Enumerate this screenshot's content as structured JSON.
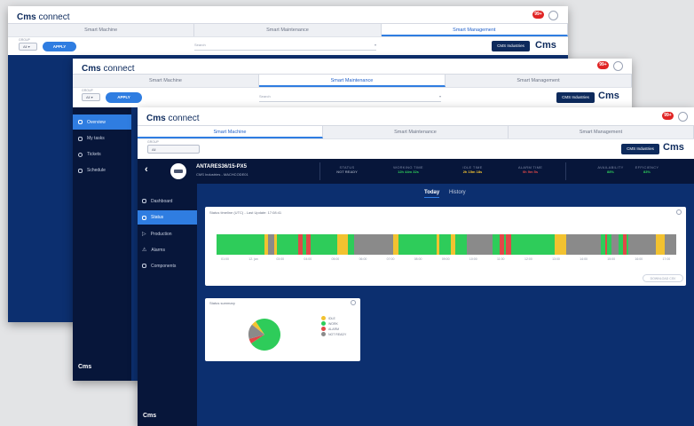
{
  "app": {
    "logo_bold": "Cms",
    "logo_light": "connect",
    "notif_count": "99+",
    "brand": "Cms"
  },
  "tabs": [
    "Smart Machine",
    "Smart Maintenance",
    "Smart Management"
  ],
  "filters": {
    "group_label": "GROUP",
    "group_value": "All",
    "apply_label": "APPLY",
    "search_placeholder": "Search",
    "company_button": "CMS Industries"
  },
  "sidebar_back": {
    "items": [
      "Overview",
      "My tasks",
      "Tickets",
      "Schedule"
    ]
  },
  "sidebar_front": {
    "items": [
      "Dashboard",
      "Status",
      "Production",
      "Alarms",
      "Components"
    ]
  },
  "machine": {
    "name": "ANTARES36/15-PX5",
    "sub": "CMS Industries - MACHCODE01",
    "back_icon": "chevron-left-icon",
    "kpis": [
      {
        "label": "STATUS",
        "value": "NOT READY",
        "color": "#8a93a8"
      },
      {
        "label": "WORKING TIME",
        "value": "12h 44m 32s",
        "color": "#2ecc5a"
      },
      {
        "label": "IDLE TIME",
        "value": "2h 15m 18s",
        "color": "#f2c230"
      },
      {
        "label": "ALARM TIME",
        "value": "0h 9m 5s",
        "color": "#e04848"
      },
      {
        "label": "AVAILABILITY",
        "value": "88%",
        "color": "#2ecc5a"
      },
      {
        "label": "EFFICIENCY",
        "value": "83%",
        "color": "#2ecc5a"
      }
    ]
  },
  "view_tabs": {
    "today": "Today",
    "history": "History"
  },
  "timeline": {
    "title": "Status timeline (UTC) - Last Update: 17:08:41",
    "ticks": [
      "01:00",
      "12. jan",
      "03:00",
      "04:00",
      "05:00",
      "06:00",
      "07:00",
      "08:00",
      "09:00",
      "10:00",
      "11:00",
      "12:00",
      "13:00",
      "14:00",
      "15:00",
      "16:00",
      "17:00"
    ],
    "download_label": "DOWNLOAD CSV",
    "colors": {
      "working": "#2ecc5a",
      "idle": "#f2c230",
      "alarm": "#e04848",
      "not_ready": "#8a8a8a"
    },
    "segments": [
      {
        "state": "working",
        "start": 0.0,
        "end": 0.105
      },
      {
        "state": "idle",
        "start": 0.105,
        "end": 0.112
      },
      {
        "state": "not_ready",
        "start": 0.112,
        "end": 0.125
      },
      {
        "state": "idle",
        "start": 0.125,
        "end": 0.132
      },
      {
        "state": "working",
        "start": 0.132,
        "end": 0.178
      },
      {
        "state": "alarm",
        "start": 0.178,
        "end": 0.188
      },
      {
        "state": "working",
        "start": 0.188,
        "end": 0.195
      },
      {
        "state": "alarm",
        "start": 0.195,
        "end": 0.205
      },
      {
        "state": "working",
        "start": 0.205,
        "end": 0.262
      },
      {
        "state": "idle",
        "start": 0.262,
        "end": 0.285
      },
      {
        "state": "working",
        "start": 0.285,
        "end": 0.3
      },
      {
        "state": "not_ready",
        "start": 0.3,
        "end": 0.385
      },
      {
        "state": "idle",
        "start": 0.385,
        "end": 0.395
      },
      {
        "state": "working",
        "start": 0.395,
        "end": 0.478
      },
      {
        "state": "idle",
        "start": 0.478,
        "end": 0.485
      },
      {
        "state": "working",
        "start": 0.485,
        "end": 0.51
      },
      {
        "state": "idle",
        "start": 0.51,
        "end": 0.52
      },
      {
        "state": "working",
        "start": 0.52,
        "end": 0.545
      },
      {
        "state": "not_ready",
        "start": 0.545,
        "end": 0.6
      },
      {
        "state": "working",
        "start": 0.6,
        "end": 0.615
      },
      {
        "state": "alarm",
        "start": 0.615,
        "end": 0.625
      },
      {
        "state": "working",
        "start": 0.625,
        "end": 0.63
      },
      {
        "state": "alarm",
        "start": 0.63,
        "end": 0.64
      },
      {
        "state": "working",
        "start": 0.64,
        "end": 0.735
      },
      {
        "state": "idle",
        "start": 0.735,
        "end": 0.76
      },
      {
        "state": "not_ready",
        "start": 0.76,
        "end": 0.835
      },
      {
        "state": "working",
        "start": 0.835,
        "end": 0.845
      },
      {
        "state": "alarm",
        "start": 0.845,
        "end": 0.85
      },
      {
        "state": "working",
        "start": 0.85,
        "end": 0.86
      },
      {
        "state": "not_ready",
        "start": 0.86,
        "end": 0.875
      },
      {
        "state": "working",
        "start": 0.875,
        "end": 0.885
      },
      {
        "state": "alarm",
        "start": 0.885,
        "end": 0.892
      },
      {
        "state": "working",
        "start": 0.892,
        "end": 0.895
      },
      {
        "state": "not_ready",
        "start": 0.895,
        "end": 0.955
      },
      {
        "state": "idle",
        "start": 0.955,
        "end": 0.975
      },
      {
        "state": "not_ready",
        "start": 0.975,
        "end": 1.0
      }
    ]
  },
  "summary": {
    "title": "Status summary",
    "legend": [
      {
        "label": "IDLE",
        "color": "#f2c230"
      },
      {
        "label": "WORK",
        "color": "#2ecc5a"
      },
      {
        "label": "ALARM",
        "color": "#e04848"
      },
      {
        "label": "NOT READY",
        "color": "#8a8a8a"
      }
    ],
    "chart_data": {
      "type": "pie",
      "categories": [
        "IDLE",
        "WORK",
        "ALARM",
        "NOT READY"
      ],
      "values": [
        5,
        75,
        5,
        15
      ]
    }
  }
}
